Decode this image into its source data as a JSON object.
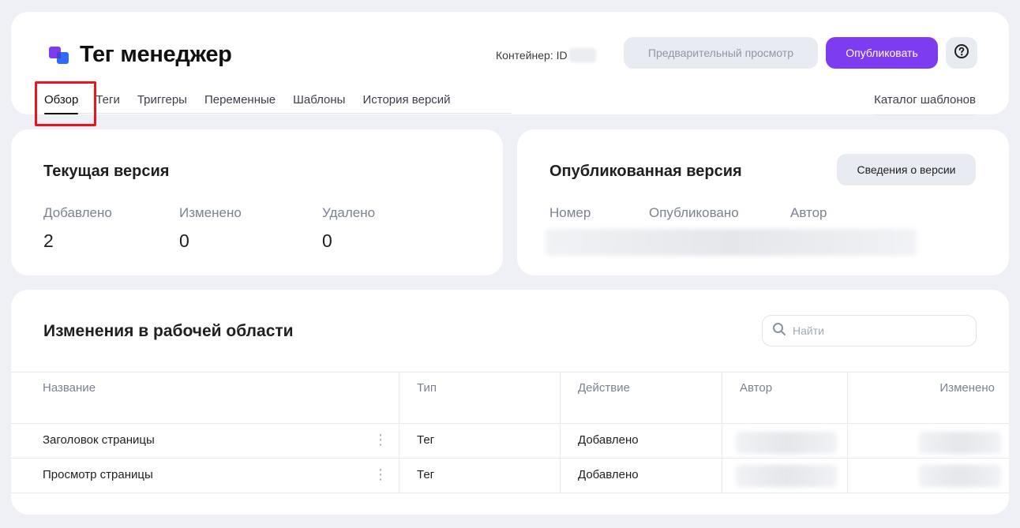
{
  "header": {
    "title": "Тег менеджер",
    "container_label": "Контейнер: ID",
    "preview_button": "Предварительный просмотр",
    "publish_button": "Опубликовать",
    "help_icon": "question-circle-icon",
    "tabs": [
      {
        "label": "Обзор",
        "active": true
      },
      {
        "label": "Теги",
        "active": false
      },
      {
        "label": "Триггеры",
        "active": false
      },
      {
        "label": "Переменные",
        "active": false
      },
      {
        "label": "Шаблоны",
        "active": false
      },
      {
        "label": "История версий",
        "active": false
      }
    ],
    "catalog_link": "Каталог шаблонов"
  },
  "current_version": {
    "title": "Текущая версия",
    "stats": [
      {
        "label": "Добавлено",
        "value": "2"
      },
      {
        "label": "Изменено",
        "value": "0"
      },
      {
        "label": "Удалено",
        "value": "0"
      }
    ]
  },
  "published_version": {
    "title": "Опубликованная версия",
    "details_button": "Сведения о версии",
    "columns": [
      "Номер",
      "Опубликовано",
      "Автор"
    ]
  },
  "changes": {
    "title": "Изменения в рабочей области",
    "search_placeholder": "Найти",
    "columns": [
      "Название",
      "Тип",
      "Действие",
      "Автор",
      "Изменено"
    ],
    "rows": [
      {
        "name": "Заголовок страницы",
        "type": "Тег",
        "action": "Добавлено"
      },
      {
        "name": "Просмотр страницы",
        "type": "Тег",
        "action": "Добавлено"
      }
    ]
  },
  "colors": {
    "accent": "#7d3cf0",
    "highlight": "#e8141f",
    "background": "#eef0f5"
  }
}
